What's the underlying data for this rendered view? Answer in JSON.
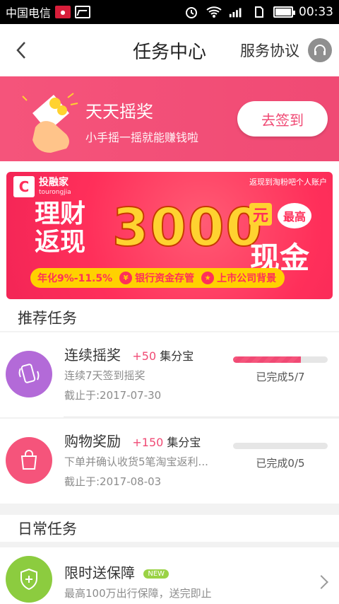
{
  "status_bar": {
    "carrier": "中国电信",
    "network": "4G 2G",
    "time": "00:33"
  },
  "header": {
    "title": "任务中心",
    "service_link": "服务协议"
  },
  "promo": {
    "title": "天天摇奖",
    "subtitle": "小手摇一摇就能赚钱啦",
    "button": "去签到",
    "color": "#f04a74"
  },
  "banner": {
    "logo_name": "投融家",
    "logo_sub": "tourongjia",
    "corner_text": "返现到淘粉吧个人账户",
    "headline_line1": "理财",
    "headline_line2": "返现",
    "amount": "3000",
    "amount_unit": "元",
    "max_tag": "最高",
    "cash": "现金",
    "rate": "年化9%-11.5%",
    "feature_1": "银行资金存管",
    "feature_2": "上市公司背景"
  },
  "sections": {
    "recommended": "推荐任务",
    "daily": "日常任务"
  },
  "recommended_tasks": [
    {
      "name": "连续摇奖",
      "reward": "+50",
      "reward_unit": "集分宝",
      "desc": "连续7天签到摇奖",
      "deadline": "截止于:2017-07-30",
      "progress_text": "已完成5/7",
      "progress": 0.714,
      "icon": "phone-shake-icon",
      "color": "#b36ad8"
    },
    {
      "name": "购物奖励",
      "reward": "+150",
      "reward_unit": "集分宝",
      "desc": "下单并确认收货5笔淘宝返利...",
      "deadline": "截止于:2017-08-03",
      "progress_text": "已完成0/5",
      "progress": 0,
      "icon": "shopping-bag-icon",
      "color": "#f5547b"
    }
  ],
  "daily_tasks": [
    {
      "name": "限时送保障",
      "badge": "NEW",
      "desc": "最高100万出行保障，送完即止",
      "icon": "shield-plus-icon",
      "color": "#8ccc3f"
    }
  ]
}
